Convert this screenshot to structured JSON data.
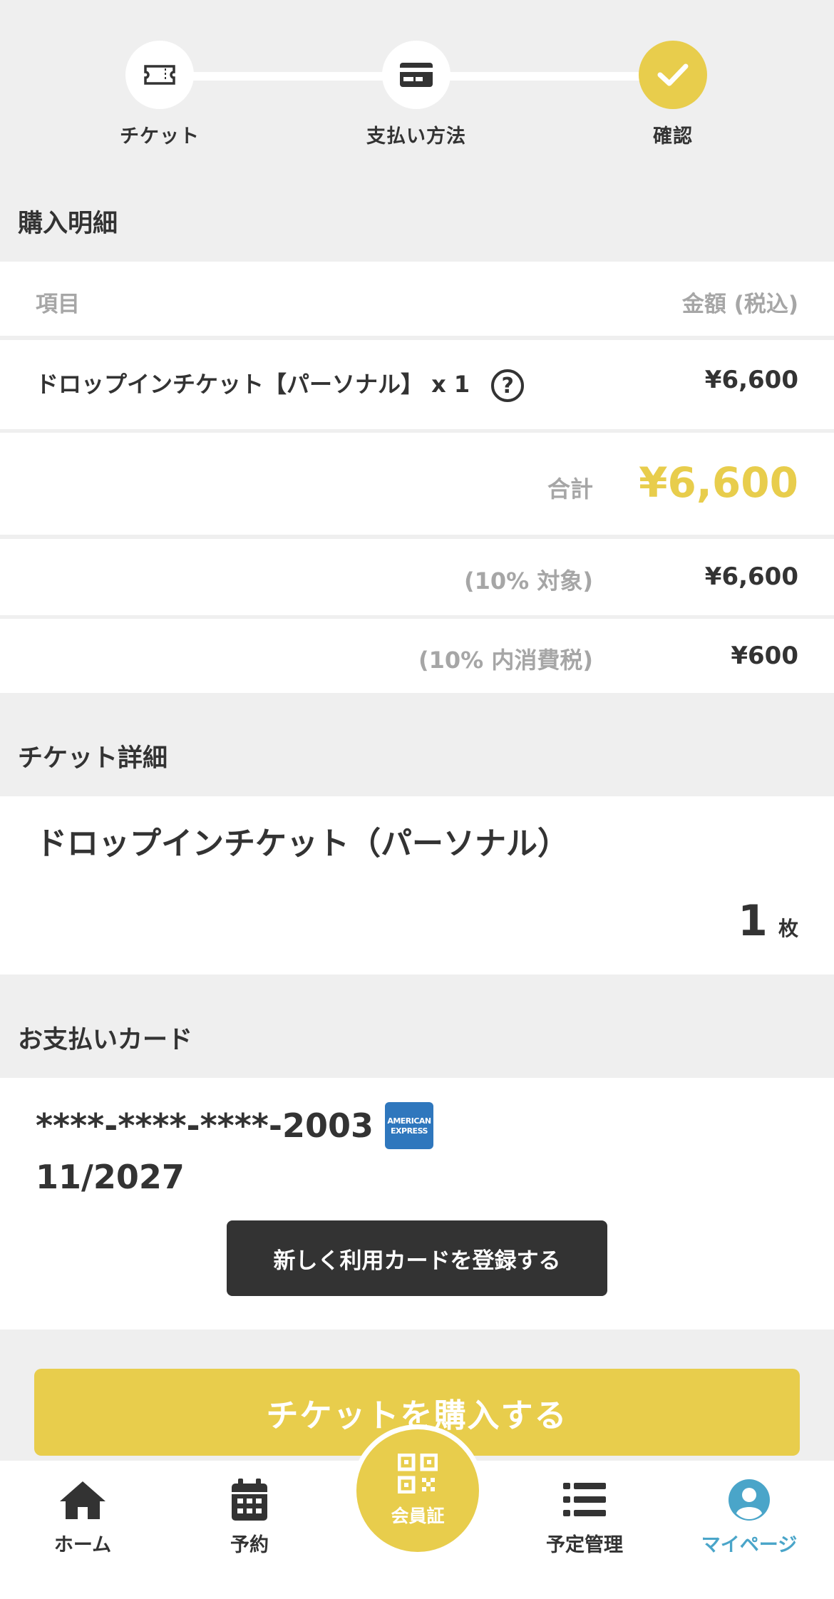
{
  "stepper": {
    "steps": [
      {
        "label": "チケット"
      },
      {
        "label": "支払い方法"
      },
      {
        "label": "確認"
      }
    ]
  },
  "purchase": {
    "title": "購入明細",
    "header_item": "項目",
    "header_amount": "金額 (税込)",
    "line_item": "ドロップインチケット【パーソナル】 x 1",
    "help_glyph": "?",
    "line_amount": "¥6,600",
    "total_label": "合計",
    "total_amount": "¥6,600",
    "tax_target_label": "(10% 対象)",
    "tax_target_amount": "¥6,600",
    "tax_included_label": "(10% 内消費税)",
    "tax_included_amount": "¥600"
  },
  "ticket": {
    "title": "チケット詳細",
    "name": "ドロップインチケット（パーソナル）",
    "count": "1",
    "unit": "枚"
  },
  "card": {
    "title": "お支払いカード",
    "number": "****-****-****-2003",
    "brand_line1": "AMERICAN",
    "brand_line2": "EXPRESS",
    "expiry": "11/2027",
    "register_button": "新しく利用カードを登録する"
  },
  "buy_button": "チケットを購入する",
  "tabbar": {
    "home": "ホーム",
    "reserve": "予約",
    "member": "会員証",
    "schedule": "予定管理",
    "mypage": "マイページ"
  },
  "colors": {
    "accent": "#e8cd4c",
    "active_tab": "#4aa5c9",
    "dark": "#333333",
    "muted": "#a6a6a6"
  }
}
